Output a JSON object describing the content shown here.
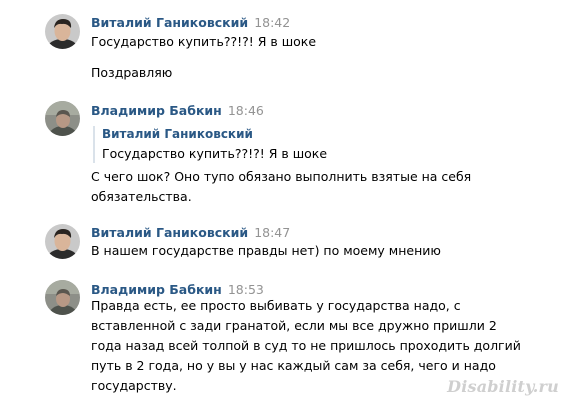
{
  "messages": [
    {
      "author": "Виталий Ганиковский",
      "time": "18:42",
      "avatar": "vitaly-photo",
      "lines": [
        "Государство купить??!?! Я в шоке",
        "Поздравляю"
      ]
    },
    {
      "author": "Владимир Бабкин",
      "time": "18:46",
      "avatar": "vladimir-photo",
      "quote": {
        "author": "Виталий Ганиковский",
        "text": "Государство купить??!?! Я в шоке"
      },
      "text": "С чего шок? Оно тупо обязано выполнить взятые на себя обязательства."
    },
    {
      "author": "Виталий Ганиковский",
      "time": "18:47",
      "avatar": "vitaly-photo",
      "text": "В нашем государстве правды нет) по моему мнению"
    },
    {
      "author": "Владимир Бабкин",
      "time": "18:53",
      "avatar": "vladimir-photo",
      "text": "Правда есть, ее просто выбивать у государства надо, с вставленной с зади гранатой, если мы все дружно пришли 2 года назад всей толпой в суд то не пришлось проходить долгий путь в 2 года, но у вы у нас каждый сам за себя, чего и надо государству."
    }
  ],
  "watermark": "Disability.ru",
  "colors": {
    "author": "#2a5885",
    "time": "#939393",
    "quote_border": "#dae2ea"
  }
}
